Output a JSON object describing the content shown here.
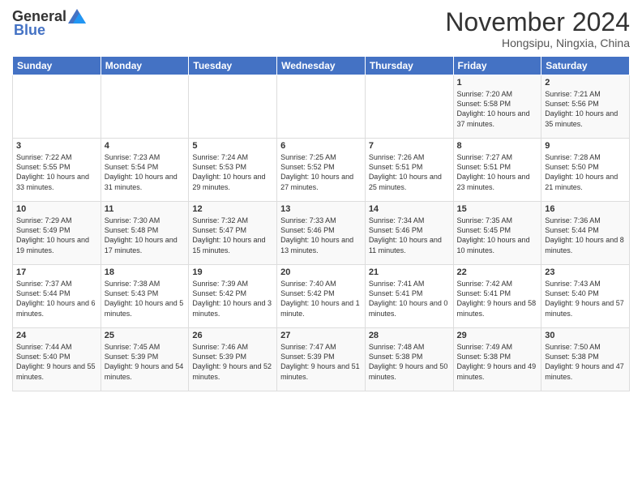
{
  "header": {
    "logo": {
      "general": "General",
      "blue": "Blue"
    },
    "title": "November 2024",
    "location": "Hongsipu, Ningxia, China"
  },
  "weekdays": [
    "Sunday",
    "Monday",
    "Tuesday",
    "Wednesday",
    "Thursday",
    "Friday",
    "Saturday"
  ],
  "rows": [
    [
      {
        "day": "",
        "info": ""
      },
      {
        "day": "",
        "info": ""
      },
      {
        "day": "",
        "info": ""
      },
      {
        "day": "",
        "info": ""
      },
      {
        "day": "",
        "info": ""
      },
      {
        "day": "1",
        "info": "Sunrise: 7:20 AM\nSunset: 5:58 PM\nDaylight: 10 hours and 37 minutes."
      },
      {
        "day": "2",
        "info": "Sunrise: 7:21 AM\nSunset: 5:56 PM\nDaylight: 10 hours and 35 minutes."
      }
    ],
    [
      {
        "day": "3",
        "info": "Sunrise: 7:22 AM\nSunset: 5:55 PM\nDaylight: 10 hours and 33 minutes."
      },
      {
        "day": "4",
        "info": "Sunrise: 7:23 AM\nSunset: 5:54 PM\nDaylight: 10 hours and 31 minutes."
      },
      {
        "day": "5",
        "info": "Sunrise: 7:24 AM\nSunset: 5:53 PM\nDaylight: 10 hours and 29 minutes."
      },
      {
        "day": "6",
        "info": "Sunrise: 7:25 AM\nSunset: 5:52 PM\nDaylight: 10 hours and 27 minutes."
      },
      {
        "day": "7",
        "info": "Sunrise: 7:26 AM\nSunset: 5:51 PM\nDaylight: 10 hours and 25 minutes."
      },
      {
        "day": "8",
        "info": "Sunrise: 7:27 AM\nSunset: 5:51 PM\nDaylight: 10 hours and 23 minutes."
      },
      {
        "day": "9",
        "info": "Sunrise: 7:28 AM\nSunset: 5:50 PM\nDaylight: 10 hours and 21 minutes."
      }
    ],
    [
      {
        "day": "10",
        "info": "Sunrise: 7:29 AM\nSunset: 5:49 PM\nDaylight: 10 hours and 19 minutes."
      },
      {
        "day": "11",
        "info": "Sunrise: 7:30 AM\nSunset: 5:48 PM\nDaylight: 10 hours and 17 minutes."
      },
      {
        "day": "12",
        "info": "Sunrise: 7:32 AM\nSunset: 5:47 PM\nDaylight: 10 hours and 15 minutes."
      },
      {
        "day": "13",
        "info": "Sunrise: 7:33 AM\nSunset: 5:46 PM\nDaylight: 10 hours and 13 minutes."
      },
      {
        "day": "14",
        "info": "Sunrise: 7:34 AM\nSunset: 5:46 PM\nDaylight: 10 hours and 11 minutes."
      },
      {
        "day": "15",
        "info": "Sunrise: 7:35 AM\nSunset: 5:45 PM\nDaylight: 10 hours and 10 minutes."
      },
      {
        "day": "16",
        "info": "Sunrise: 7:36 AM\nSunset: 5:44 PM\nDaylight: 10 hours and 8 minutes."
      }
    ],
    [
      {
        "day": "17",
        "info": "Sunrise: 7:37 AM\nSunset: 5:44 PM\nDaylight: 10 hours and 6 minutes."
      },
      {
        "day": "18",
        "info": "Sunrise: 7:38 AM\nSunset: 5:43 PM\nDaylight: 10 hours and 5 minutes."
      },
      {
        "day": "19",
        "info": "Sunrise: 7:39 AM\nSunset: 5:42 PM\nDaylight: 10 hours and 3 minutes."
      },
      {
        "day": "20",
        "info": "Sunrise: 7:40 AM\nSunset: 5:42 PM\nDaylight: 10 hours and 1 minute."
      },
      {
        "day": "21",
        "info": "Sunrise: 7:41 AM\nSunset: 5:41 PM\nDaylight: 10 hours and 0 minutes."
      },
      {
        "day": "22",
        "info": "Sunrise: 7:42 AM\nSunset: 5:41 PM\nDaylight: 9 hours and 58 minutes."
      },
      {
        "day": "23",
        "info": "Sunrise: 7:43 AM\nSunset: 5:40 PM\nDaylight: 9 hours and 57 minutes."
      }
    ],
    [
      {
        "day": "24",
        "info": "Sunrise: 7:44 AM\nSunset: 5:40 PM\nDaylight: 9 hours and 55 minutes."
      },
      {
        "day": "25",
        "info": "Sunrise: 7:45 AM\nSunset: 5:39 PM\nDaylight: 9 hours and 54 minutes."
      },
      {
        "day": "26",
        "info": "Sunrise: 7:46 AM\nSunset: 5:39 PM\nDaylight: 9 hours and 52 minutes."
      },
      {
        "day": "27",
        "info": "Sunrise: 7:47 AM\nSunset: 5:39 PM\nDaylight: 9 hours and 51 minutes."
      },
      {
        "day": "28",
        "info": "Sunrise: 7:48 AM\nSunset: 5:38 PM\nDaylight: 9 hours and 50 minutes."
      },
      {
        "day": "29",
        "info": "Sunrise: 7:49 AM\nSunset: 5:38 PM\nDaylight: 9 hours and 49 minutes."
      },
      {
        "day": "30",
        "info": "Sunrise: 7:50 AM\nSunset: 5:38 PM\nDaylight: 9 hours and 47 minutes."
      }
    ]
  ]
}
